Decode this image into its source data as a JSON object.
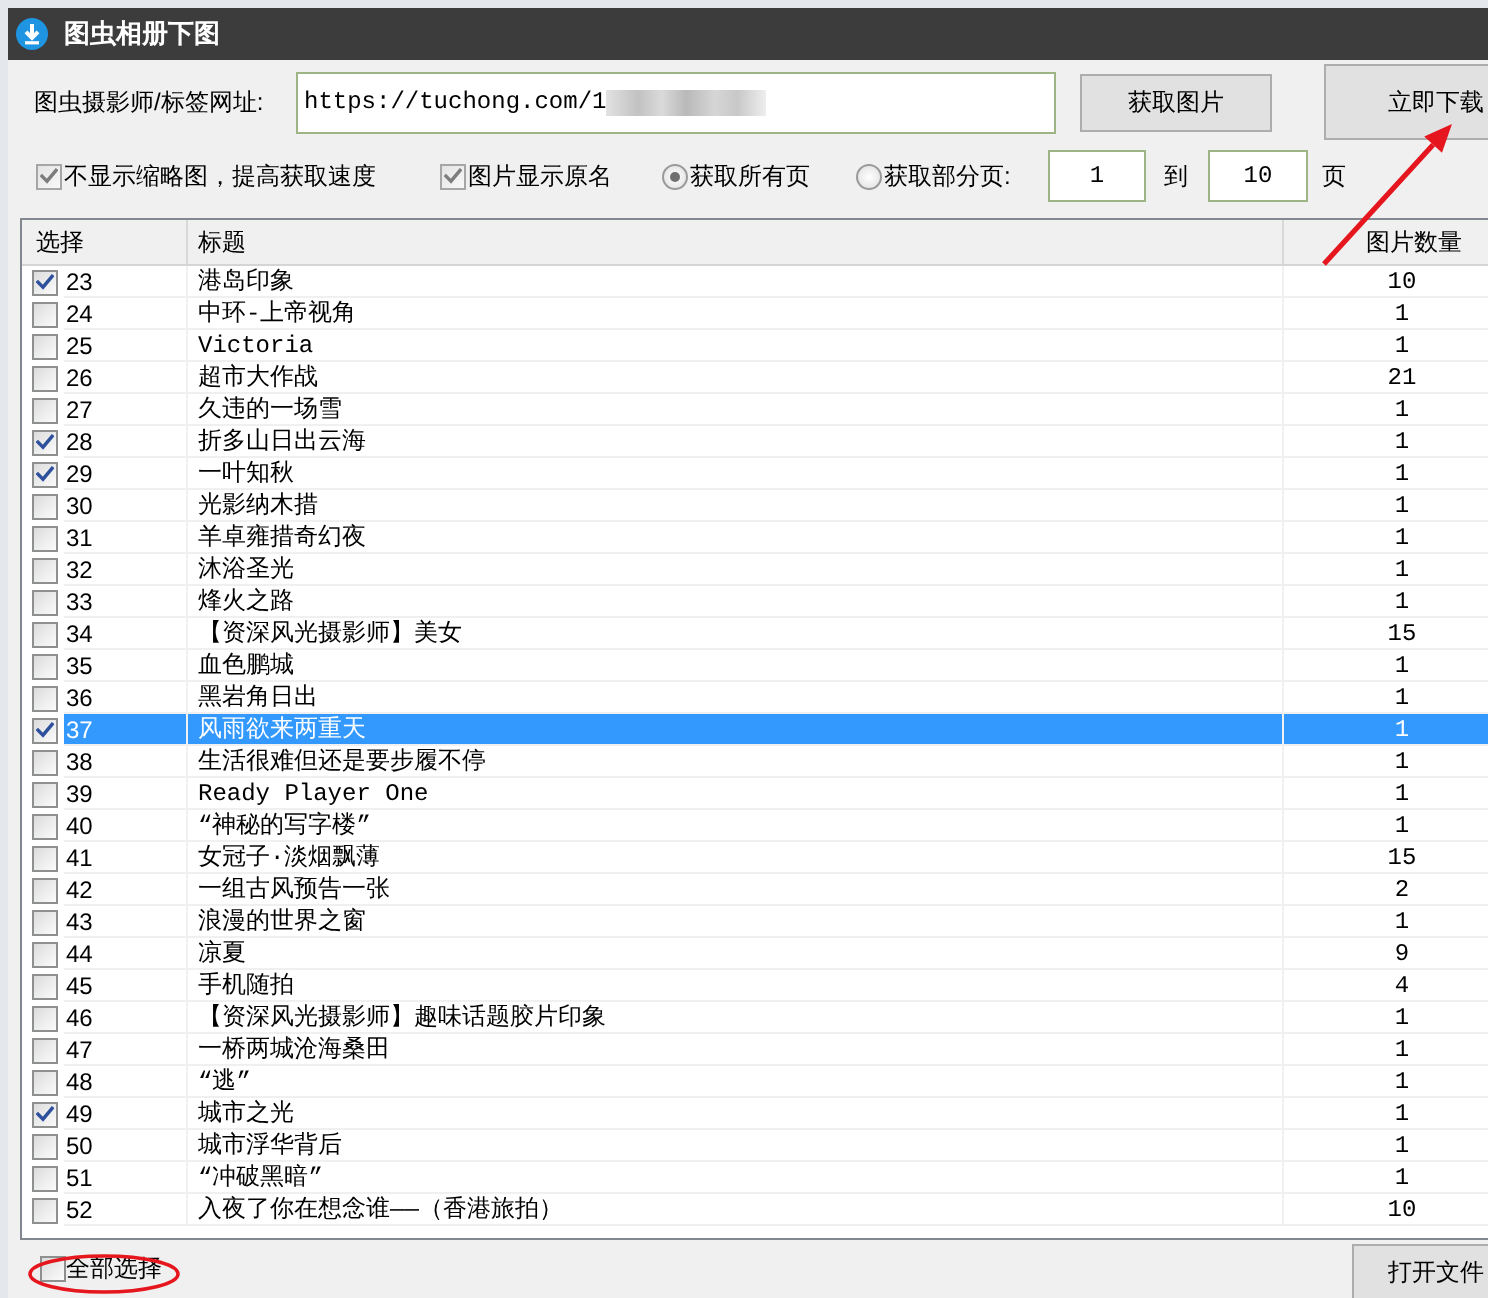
{
  "window": {
    "title": "图虫相册下图"
  },
  "url_row": {
    "label": "图虫摄影师/标签网址:",
    "url": "https://tuchong.com/1",
    "redacted": true,
    "buttons": [
      {
        "label": "获取图片"
      },
      {
        "label": "立即下载"
      }
    ]
  },
  "options": [
    {
      "kind": "checkbox",
      "label": "不显示缩略图，提高获取速度",
      "checked": true
    },
    {
      "kind": "checkbox",
      "label": "图片显示原名",
      "checked": true
    },
    {
      "kind": "radio",
      "label": "获取所有页",
      "selected": true
    },
    {
      "kind": "radio",
      "label": "获取部分页:",
      "selected": false
    }
  ],
  "page_range": {
    "from": "1",
    "separator": "到",
    "to": "10",
    "unit": "页"
  },
  "table": {
    "columns": [
      "选择",
      "标题",
      "图片数量"
    ],
    "rows": [
      {
        "no": "23",
        "title": "港岛印象",
        "count": "10",
        "checked": true,
        "selected": false
      },
      {
        "no": "24",
        "title": "中环-上帝视角",
        "count": "1",
        "checked": false,
        "selected": false
      },
      {
        "no": "25",
        "title": "Victoria",
        "count": "1",
        "checked": false,
        "selected": false
      },
      {
        "no": "26",
        "title": "超市大作战",
        "count": "21",
        "checked": false,
        "selected": false
      },
      {
        "no": "27",
        "title": "久违的一场雪",
        "count": "1",
        "checked": false,
        "selected": false
      },
      {
        "no": "28",
        "title": "折多山日出云海",
        "count": "1",
        "checked": true,
        "selected": false
      },
      {
        "no": "29",
        "title": "一叶知秋",
        "count": "1",
        "checked": true,
        "selected": false
      },
      {
        "no": "30",
        "title": "光影纳木措",
        "count": "1",
        "checked": false,
        "selected": false
      },
      {
        "no": "31",
        "title": "羊卓雍措奇幻夜",
        "count": "1",
        "checked": false,
        "selected": false
      },
      {
        "no": "32",
        "title": "沐浴圣光",
        "count": "1",
        "checked": false,
        "selected": false
      },
      {
        "no": "33",
        "title": "烽火之路",
        "count": "1",
        "checked": false,
        "selected": false
      },
      {
        "no": "34",
        "title": "【资深风光摄影师】美女",
        "count": "15",
        "checked": false,
        "selected": false
      },
      {
        "no": "35",
        "title": "血色鹏城",
        "count": "1",
        "checked": false,
        "selected": false
      },
      {
        "no": "36",
        "title": "黑岩角日出",
        "count": "1",
        "checked": false,
        "selected": false
      },
      {
        "no": "37",
        "title": "风雨欲来两重天",
        "count": "1",
        "checked": true,
        "selected": true
      },
      {
        "no": "38",
        "title": "生活很难但还是要步履不停",
        "count": "1",
        "checked": false,
        "selected": false
      },
      {
        "no": "39",
        "title": "Ready Player One",
        "count": "1",
        "checked": false,
        "selected": false
      },
      {
        "no": "40",
        "title": "“神秘的写字楼”",
        "count": "1",
        "checked": false,
        "selected": false
      },
      {
        "no": "41",
        "title": "女冠子·淡烟飘薄",
        "count": "15",
        "checked": false,
        "selected": false
      },
      {
        "no": "42",
        "title": "一组古风预告一张",
        "count": "2",
        "checked": false,
        "selected": false
      },
      {
        "no": "43",
        "title": "浪漫的世界之窗",
        "count": "1",
        "checked": false,
        "selected": false
      },
      {
        "no": "44",
        "title": "凉夏",
        "count": "9",
        "checked": false,
        "selected": false
      },
      {
        "no": "45",
        "title": "手机随拍",
        "count": "4",
        "checked": false,
        "selected": false
      },
      {
        "no": "46",
        "title": "【资深风光摄影师】趣味话题胶片印象",
        "count": "1",
        "checked": false,
        "selected": false
      },
      {
        "no": "47",
        "title": "一桥两城沧海桑田",
        "count": "1",
        "checked": false,
        "selected": false
      },
      {
        "no": "48",
        "title": "“逃”",
        "count": "1",
        "checked": false,
        "selected": false
      },
      {
        "no": "49",
        "title": "城市之光",
        "count": "1",
        "checked": true,
        "selected": false
      },
      {
        "no": "50",
        "title": "城市浮华背后",
        "count": "1",
        "checked": false,
        "selected": false
      },
      {
        "no": "51",
        "title": "“冲破黑暗”",
        "count": "1",
        "checked": false,
        "selected": false
      },
      {
        "no": "52",
        "title": "入夜了你在想念谁——（香港旅拍）",
        "count": "10",
        "checked": false,
        "selected": false
      }
    ]
  },
  "footer": {
    "select_all": {
      "label": "全部选择",
      "checked": false
    },
    "button": "打开文件"
  }
}
